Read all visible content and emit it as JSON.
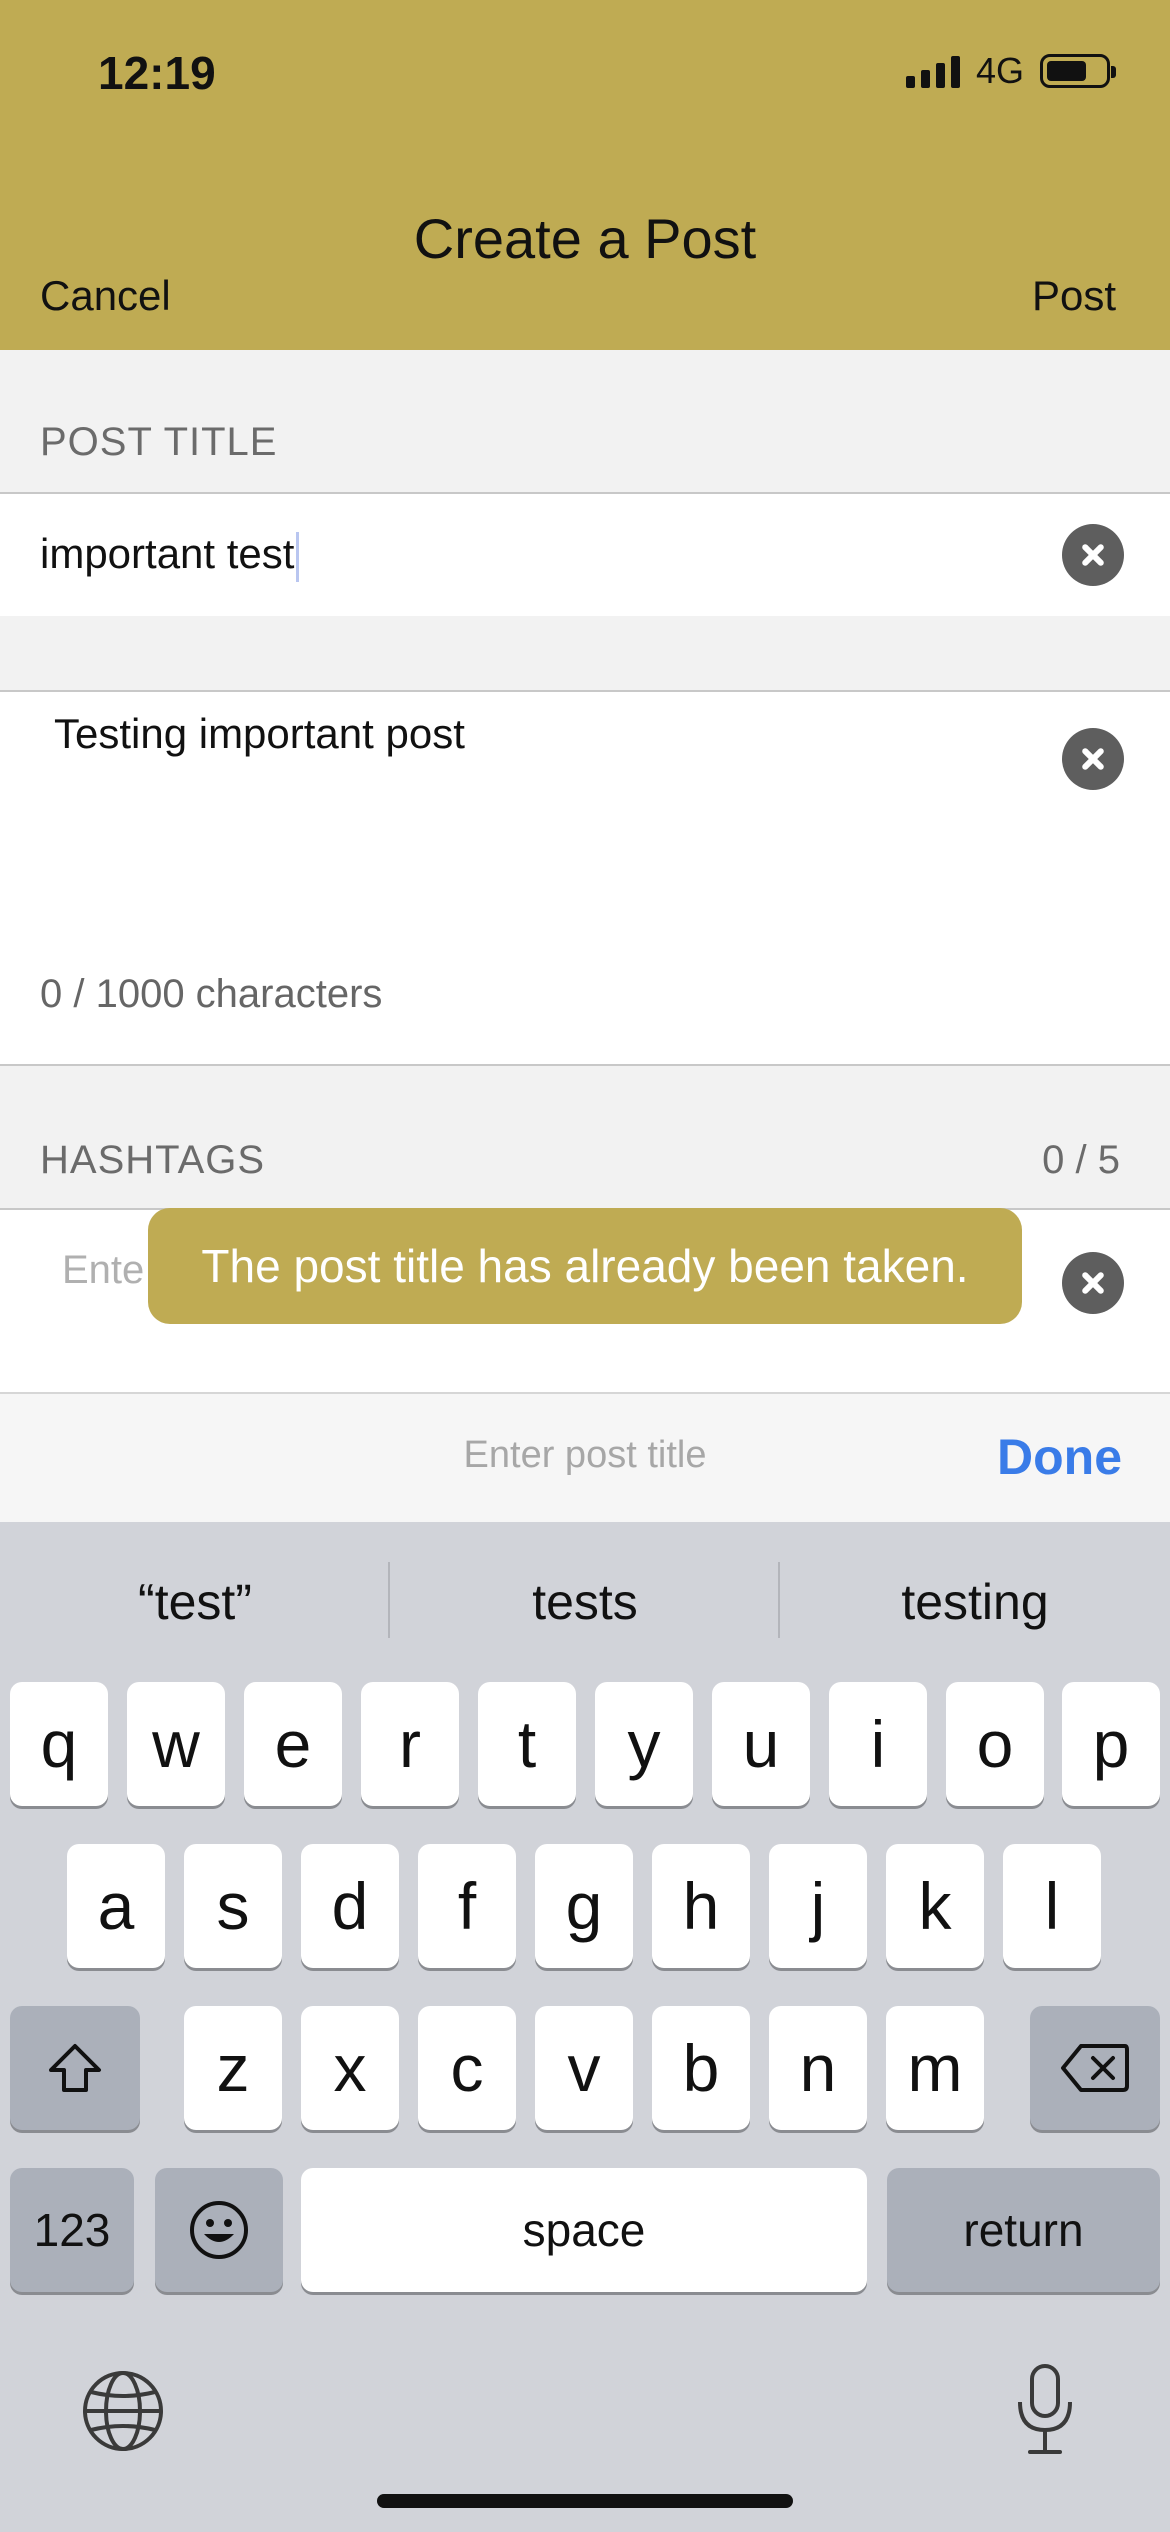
{
  "status_bar": {
    "time": "12:19",
    "network": "4G"
  },
  "nav": {
    "title": "Create a Post",
    "cancel_label": "Cancel",
    "post_label": "Post"
  },
  "form": {
    "post_title_label": "POST TITLE",
    "post_title_value": "important test",
    "body_value": "Testing important post",
    "char_count": "0 / 1000 characters",
    "hashtags_label": "HASHTAGS",
    "hashtags_count": "0 / 5",
    "hashtags_placeholder_partial": "Ente"
  },
  "toast": {
    "message": "The post title has already been taken."
  },
  "accessory_bar": {
    "placeholder": "Enter post title",
    "done_label": "Done"
  },
  "keyboard": {
    "suggestions": [
      "“test”",
      "tests",
      "testing"
    ],
    "row1": [
      "q",
      "w",
      "e",
      "r",
      "t",
      "y",
      "u",
      "i",
      "o",
      "p"
    ],
    "row2": [
      "a",
      "s",
      "d",
      "f",
      "g",
      "h",
      "j",
      "k",
      "l"
    ],
    "row3": [
      "z",
      "x",
      "c",
      "v",
      "b",
      "n",
      "m"
    ],
    "numbers_label": "123",
    "space_label": "space",
    "return_label": "return"
  },
  "colors": {
    "accent": "#bfab53",
    "done_blue": "#3a7ce8",
    "keyboard_bg": "#d1d3d9"
  },
  "icons": [
    "signal-icon",
    "battery-icon",
    "clear-icon",
    "shift-icon",
    "backspace-icon",
    "emoji-icon",
    "globe-icon",
    "microphone-icon"
  ]
}
